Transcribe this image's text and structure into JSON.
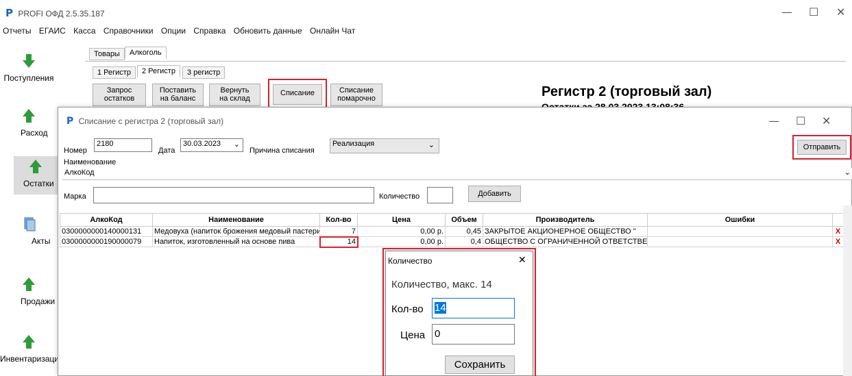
{
  "app": {
    "title": "PROFI ОФД 2.5.35.187",
    "logo": "P"
  },
  "window_controls": {
    "minimize": "—",
    "maximize": "☐",
    "close": "✕"
  },
  "menu": [
    "Отчеты",
    "ЕГАИС",
    "Касса",
    "Справочники",
    "Опции",
    "Справка",
    "Обновить данные",
    "Онлайн Чат"
  ],
  "sidebar": [
    {
      "label": "Поступления",
      "icon": "arrow-down-icon"
    },
    {
      "label": "Расход",
      "icon": "arrow-up-icon"
    },
    {
      "label": "Остатки",
      "icon": "arrow-up-icon"
    },
    {
      "label": "Акты",
      "icon": "documents-icon"
    },
    {
      "label": "Продажи",
      "icon": "arrow-up-icon"
    },
    {
      "label": "Инвентаризация",
      "icon": "arrow-up-icon"
    }
  ],
  "tabs_top": [
    "Товары",
    "Алкоголь"
  ],
  "tabs_register": [
    "1 Регистр",
    "2 Регистр",
    "3 регистр"
  ],
  "toolbar": {
    "request_balance": [
      "Запрос",
      "остатков"
    ],
    "put_balance": [
      "Поставить",
      "на баланс"
    ],
    "return_stock": [
      "Вернуть",
      "на склад"
    ],
    "writeoff": "Списание",
    "writeoff_byitem": [
      "Списание",
      "помарочно"
    ]
  },
  "register_header": {
    "title": "Регистр  2 (торговый зал)",
    "subtitle": "Остатки за 28.03.2023 13:08:36"
  },
  "dialog": {
    "title": "Списание с регистра 2 (торговый зал)",
    "number_label": "Номер",
    "number_value": "2180",
    "date_label": "Дата",
    "date_value": "30.03.2023",
    "reason_label": "Причина списания",
    "reason_value": "Реализация",
    "send_button": "Отправить",
    "name_label": "Наименование",
    "name_value": "АлкоКод",
    "mark_label": "Марка",
    "qty_label": "Количество",
    "add_button": "Добавить",
    "columns": [
      "АлкоКод",
      "Наименование",
      "Кол-во",
      "Цена",
      "Объем",
      "Производитель",
      "Ошибки"
    ],
    "rows": [
      {
        "code": "0300000000140000131",
        "name": "Медовуха (напиток брожения медовый пастеризованный)",
        "qty": "7",
        "price": "0,00 р.",
        "volume": "0,45",
        "producer": "ЗАКРЫТОЕ АКЦИОНЕРНОЕ ОБЩЕСТВО \"",
        "errors": "",
        "del": "X"
      },
      {
        "code": "0300000000190000079",
        "name": "Напиток, изготовленный на основе пива",
        "qty": "14",
        "price": "0,00 р.",
        "volume": "0,4",
        "producer": "ОБЩЕСТВО С ОГРАНИЧЕННОЙ ОТВЕТСТВЕННОСТЬЮ",
        "errors": "",
        "del": "X"
      }
    ]
  },
  "popup": {
    "title": "Количество",
    "close": "✕",
    "max_text": "Количество, макс. 14",
    "qty_label": "Кол-во",
    "qty_value": "14",
    "price_label": "Цена",
    "price_value": "0",
    "save_button": "Сохранить"
  },
  "colors": {
    "highlight": "#d9202e",
    "arrow_green": "#2e9b3a",
    "logo_blue": "#1565c0"
  }
}
